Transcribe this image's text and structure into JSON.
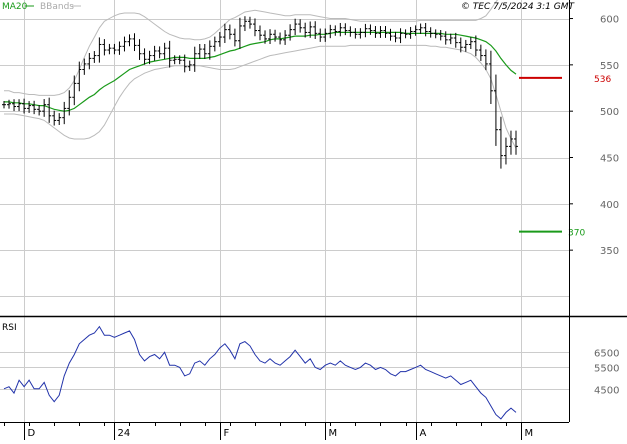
{
  "header": {
    "ma_label": "MA20",
    "bb_label": "BBands",
    "copyright": "© TEC 7/5/2024 3:1 GMT"
  },
  "colors": {
    "price_bars": "#000000",
    "ma20": "#1a9a1a",
    "bbands": "#bbbbbb",
    "rsi_line": "#2233aa",
    "resistance": "#cc0000",
    "support": "#1a9a1a",
    "grid": "#cccccc",
    "panel_bg": "#ffffff",
    "axis_text": "#666666"
  },
  "chart_data": [
    {
      "type": "ohlc",
      "title": "",
      "legend": [
        "MA20",
        "BBands"
      ],
      "ylim": [
        280,
        620
      ],
      "y_ticks": [
        350,
        400,
        450,
        500,
        550,
        600
      ],
      "x_labels": [
        "D",
        "24",
        "F",
        "M",
        "A",
        "M"
      ],
      "x_label_bar_index": [
        4,
        22,
        43,
        64,
        82,
        103
      ],
      "grid": true,
      "levels": [
        {
          "value": 536,
          "label": "536",
          "color": "#cc0000"
        },
        {
          "value": 370,
          "label": "370",
          "color": "#1a9a1a"
        }
      ],
      "series": [
        {
          "name": "Close",
          "close": [
            507,
            508,
            505,
            508,
            503,
            506,
            502,
            500,
            507,
            495,
            490,
            493,
            503,
            515,
            530,
            545,
            551,
            557,
            560,
            572,
            566,
            568,
            566,
            570,
            575,
            578,
            571,
            562,
            556,
            560,
            565,
            562,
            568,
            555,
            556,
            555,
            548,
            550,
            562,
            567,
            562,
            570,
            575,
            580,
            588,
            583,
            576,
            592,
            597,
            594,
            587,
            582,
            578,
            583,
            580,
            577,
            582,
            588,
            594,
            590,
            585,
            591,
            584,
            580,
            584,
            588,
            586,
            590,
            587,
            585,
            583,
            585,
            589,
            587,
            584,
            587,
            584,
            581,
            579,
            584,
            583,
            586,
            588,
            590,
            586,
            584,
            583,
            581,
            577,
            579,
            574,
            569,
            572,
            575,
            566,
            560,
            551,
            522,
            480,
            452,
            462,
            470,
            462
          ]
        },
        {
          "name": "MA20",
          "values": [
            510,
            510,
            509,
            509,
            508,
            508,
            507,
            506,
            506,
            504,
            502,
            501,
            500,
            501,
            503,
            507,
            511,
            515,
            518,
            523,
            527,
            530,
            533,
            537,
            541,
            545,
            547,
            549,
            551,
            553,
            554,
            555,
            556,
            557,
            558,
            558,
            558,
            557,
            557,
            557,
            557,
            558,
            559,
            561,
            563,
            565,
            566,
            568,
            570,
            572,
            573,
            574,
            575,
            577,
            578,
            578,
            579,
            580,
            581,
            581,
            581,
            582,
            582,
            583,
            583,
            584,
            585,
            585,
            585,
            585,
            585,
            585,
            585,
            585,
            585,
            585,
            585,
            585,
            585,
            585,
            584,
            584,
            584,
            584,
            584,
            584,
            584,
            584,
            583,
            583,
            583,
            582,
            581,
            580,
            579,
            577,
            575,
            571,
            565,
            557,
            550,
            544,
            540
          ]
        },
        {
          "name": "BBands",
          "upper": [
            522,
            522,
            520,
            520,
            519,
            518,
            518,
            517,
            517,
            517,
            517,
            518,
            520,
            525,
            533,
            545,
            558,
            570,
            580,
            590,
            597,
            600,
            603,
            605,
            606,
            606,
            606,
            605,
            602,
            598,
            594,
            590,
            586,
            583,
            581,
            579,
            578,
            578,
            577,
            577,
            578,
            580,
            584,
            589,
            594,
            599,
            601,
            604,
            607,
            608,
            609,
            608,
            607,
            606,
            605,
            604,
            603,
            603,
            604,
            604,
            604,
            604,
            603,
            602,
            601,
            600,
            600,
            600,
            600,
            599,
            598,
            597,
            597,
            597,
            597,
            597,
            597,
            597,
            597,
            597,
            597,
            597,
            597,
            598,
            598,
            598,
            598,
            598,
            598,
            598,
            598,
            598,
            598,
            598,
            598,
            600,
            603,
            610,
            618,
            625,
            630,
            634,
            636
          ],
          "lower": [
            497,
            497,
            497,
            496,
            495,
            494,
            493,
            492,
            490,
            486,
            482,
            478,
            474,
            471,
            470,
            470,
            470,
            471,
            474,
            478,
            485,
            495,
            505,
            515,
            523,
            530,
            535,
            538,
            541,
            543,
            545,
            546,
            547,
            548,
            549,
            549,
            549,
            549,
            549,
            549,
            548,
            547,
            546,
            545,
            545,
            545,
            546,
            548,
            550,
            552,
            554,
            556,
            558,
            560,
            561,
            562,
            563,
            564,
            565,
            566,
            567,
            568,
            569,
            570,
            570,
            570,
            570,
            570,
            570,
            571,
            571,
            571,
            571,
            571,
            571,
            571,
            571,
            571,
            571,
            571,
            571,
            571,
            571,
            571,
            571,
            570,
            570,
            569,
            569,
            568,
            567,
            566,
            564,
            562,
            558,
            552,
            545,
            535,
            518,
            500,
            482,
            470,
            460
          ]
        }
      ]
    },
    {
      "type": "line",
      "title": "RSI",
      "ylim": [
        30,
        78
      ],
      "y_ticks_labeled": [
        "6500",
        "5500",
        "4500"
      ],
      "y_tick_values": [
        62,
        55,
        45
      ],
      "series": [
        {
          "name": "RSI",
          "values": [
            45,
            46,
            43,
            49,
            46,
            49,
            45,
            45,
            48,
            42,
            39,
            42,
            51,
            57,
            61,
            66,
            68,
            70,
            71,
            74,
            70,
            70,
            69,
            70,
            71,
            72,
            68,
            61,
            58,
            60,
            61,
            59,
            62,
            56,
            56,
            55,
            51,
            52,
            57,
            58,
            56,
            59,
            61,
            64,
            66,
            63,
            59,
            66,
            67,
            65,
            61,
            58,
            57,
            59,
            57,
            56,
            58,
            60,
            63,
            60,
            57,
            59,
            55,
            54,
            56,
            57,
            56,
            58,
            56,
            55,
            54,
            55,
            57,
            56,
            54,
            55,
            54,
            52,
            51,
            53,
            53,
            54,
            55,
            56,
            54,
            53,
            52,
            51,
            50,
            51,
            49,
            47,
            48,
            49,
            46,
            43,
            41,
            37,
            33,
            31,
            34,
            36,
            34
          ]
        }
      ]
    }
  ]
}
